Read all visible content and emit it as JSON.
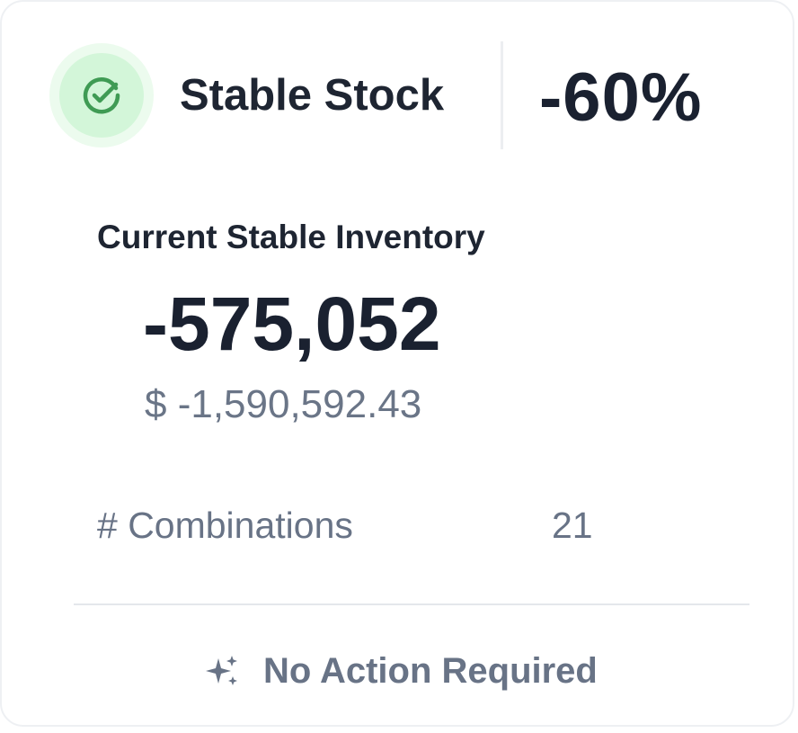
{
  "card": {
    "status": {
      "icon": "check-circle-icon",
      "title": "Stable Stock",
      "percent": "-60%",
      "accent_color": "#3f9b54",
      "icon_bg": "#d3f6d9"
    },
    "inventory": {
      "label": "Current Stable Inventory",
      "units": "-575,052",
      "value": "$ -1,590,592.43"
    },
    "combinations": {
      "label": "# Combinations",
      "count": "21"
    },
    "footer": {
      "icon": "sparkle-icon",
      "text": "No Action Required"
    }
  }
}
